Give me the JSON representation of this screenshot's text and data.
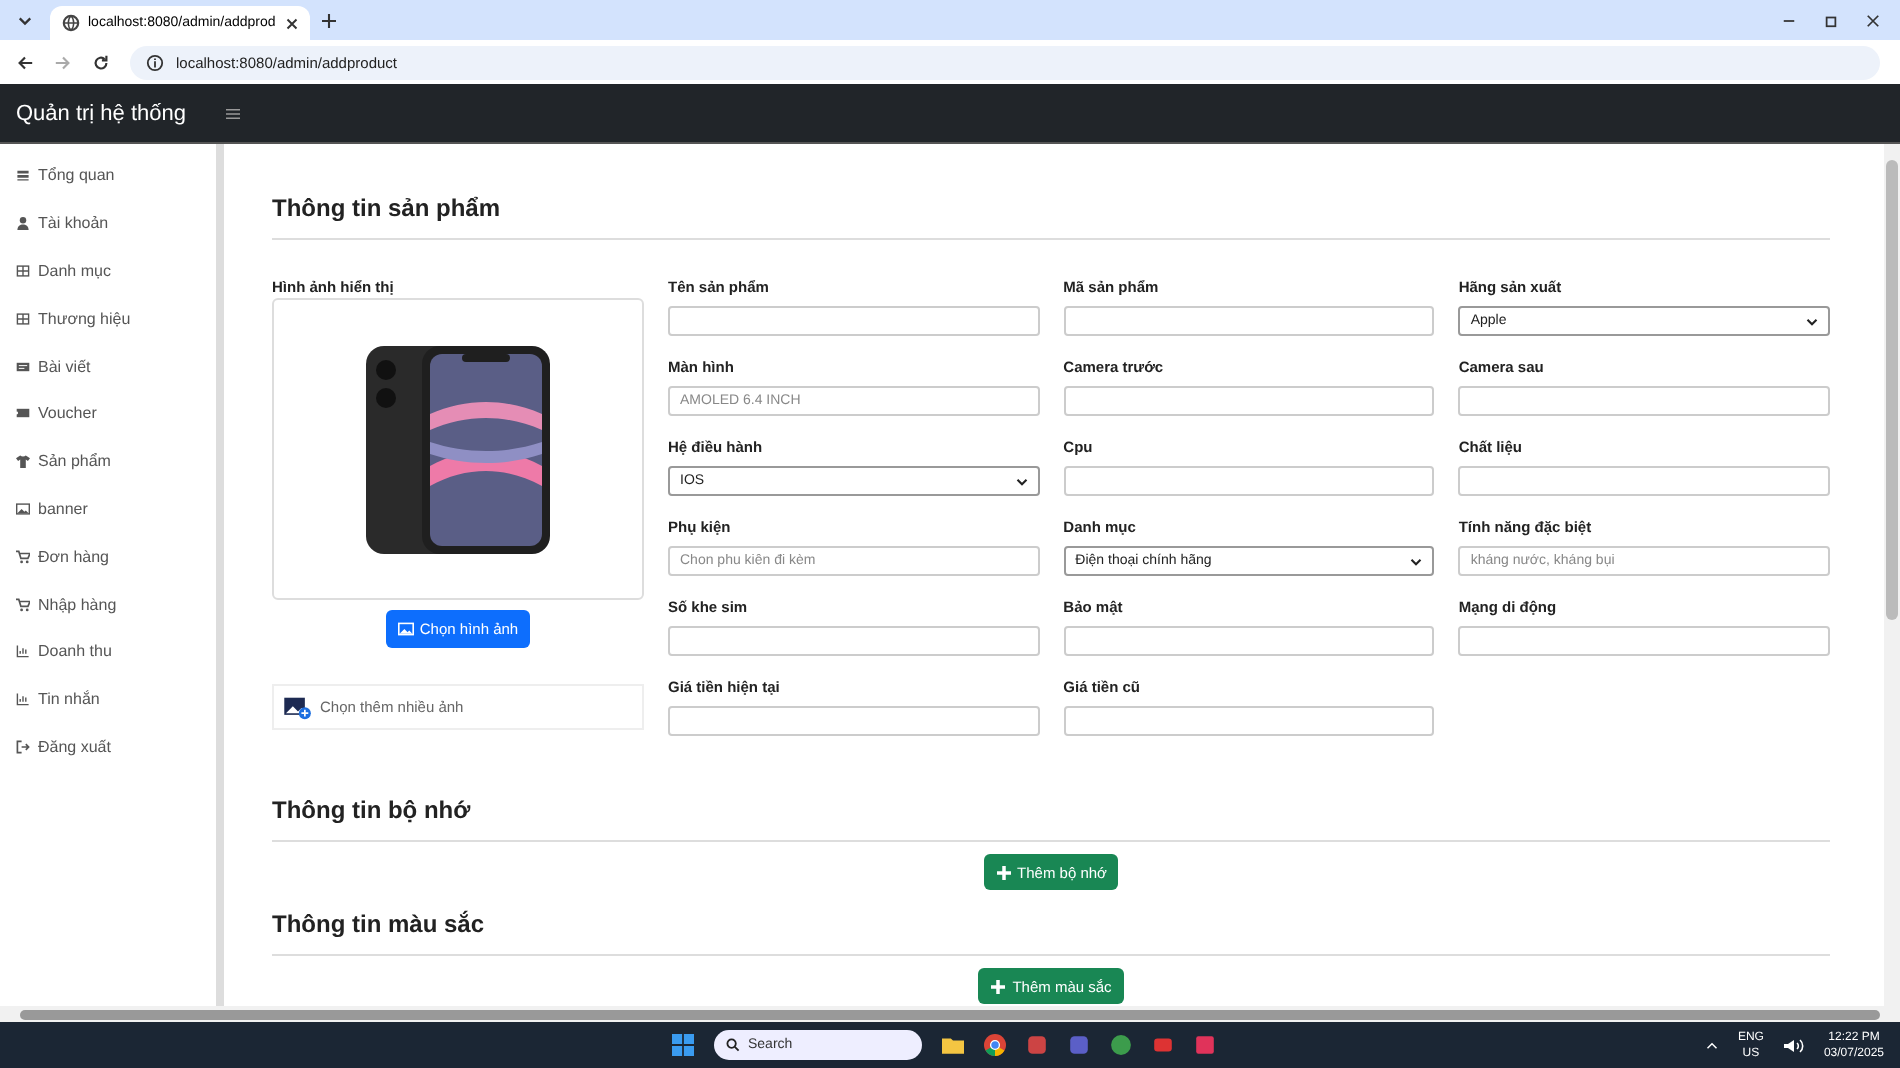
{
  "browser": {
    "tab_title": "localhost:8080/admin/addprod",
    "url": "localhost:8080/admin/addproduct"
  },
  "navbar": {
    "title": "Quản trị hệ thống"
  },
  "sidebar": {
    "items": [
      {
        "label": "Tổng quan",
        "selected": false
      },
      {
        "label": "Tài khoản",
        "selected": false
      },
      {
        "label": "Danh mục",
        "selected": false
      },
      {
        "label": "Thương hiệu",
        "selected": false
      },
      {
        "label": "Bài viết",
        "selected": false
      },
      {
        "label": "Voucher",
        "selected": false
      },
      {
        "label": "Sản phẩm",
        "selected": false
      },
      {
        "label": "banner",
        "selected": false
      },
      {
        "label": "Đơn hàng",
        "selected": false
      },
      {
        "label": "Nhập hàng",
        "selected": false
      },
      {
        "label": "Doanh thu",
        "selected": false
      },
      {
        "label": "Tin nhắn",
        "selected": false
      },
      {
        "label": "Đăng xuất",
        "selected": false
      }
    ]
  },
  "product_section": {
    "title": "Thông tin sản phẩm",
    "image_label": "Hình ảnh hiển thị",
    "choose_image_button": "Chọn hình ảnh",
    "multi_image_picker": "Chọn thêm nhiều ảnh",
    "fields": [
      {
        "label": "Tên sản phẩm",
        "kind": "input"
      },
      {
        "label": "Mã sản phẩm",
        "kind": "input"
      },
      {
        "label": "Hãng sản xuất",
        "kind": "select",
        "value": "Apple"
      },
      {
        "label": "Màn hình",
        "kind": "input",
        "placeholder": "AMOLED 6.4 INCH"
      },
      {
        "label": "Camera trước",
        "kind": "input"
      },
      {
        "label": "Camera sau",
        "kind": "input"
      },
      {
        "label": "Hệ điều hành",
        "kind": "select",
        "value": "IOS"
      },
      {
        "label": "Cpu",
        "kind": "input"
      },
      {
        "label": "Chất liệu",
        "kind": "input"
      },
      {
        "label": "Phụ kiện",
        "kind": "input",
        "placeholder": "Chon phu kiên đi kèm"
      },
      {
        "label": "Danh mục",
        "kind": "select",
        "value": "Điện thoại chính hãng"
      },
      {
        "label": "Tính năng đặc biệt",
        "kind": "input",
        "placeholder": "kháng nước, kháng bụi"
      },
      {
        "label": "Số khe sim",
        "kind": "input"
      },
      {
        "label": "Bảo mật",
        "kind": "input"
      },
      {
        "label": "Mạng di động",
        "kind": "input"
      },
      {
        "label": "Giá tiền hiện tại",
        "kind": "input"
      },
      {
        "label": "Giá tiền cũ",
        "kind": "input"
      }
    ]
  },
  "memory_section": {
    "title": "Thông tin bộ nhớ",
    "button": "Thêm bộ nhớ"
  },
  "color_section": {
    "title": "Thông tin màu sắc",
    "button": "Thêm màu sắc"
  },
  "taskbar": {
    "search": "Search",
    "language": "ENG",
    "region": "US",
    "time": "12:22 PM",
    "date": "03/07/2025"
  }
}
